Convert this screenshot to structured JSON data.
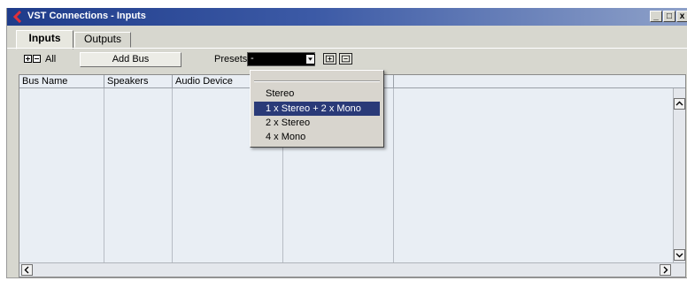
{
  "window": {
    "title": "VST Connections - Inputs",
    "controls": {
      "minimize": "_",
      "restore": "□",
      "close": "x"
    }
  },
  "tabs": [
    {
      "label": "Inputs",
      "active": true
    },
    {
      "label": "Outputs",
      "active": false
    }
  ],
  "toolbar": {
    "expand_all_label": "All",
    "add_bus_label": "Add Bus",
    "presets_label": "Presets",
    "presets_value": "-"
  },
  "table": {
    "columns": [
      "Bus Name",
      "Speakers",
      "Audio Device",
      "",
      ""
    ]
  },
  "presets_menu": {
    "items": [
      "Stereo",
      "1 x Stereo + 2 x Mono",
      "2 x Stereo",
      "4 x Mono"
    ],
    "selected_index": 1
  },
  "colors": {
    "titlebar_start": "#1f3c8a",
    "selection": "#2a3a78",
    "table_bg": "#e9eef4"
  }
}
